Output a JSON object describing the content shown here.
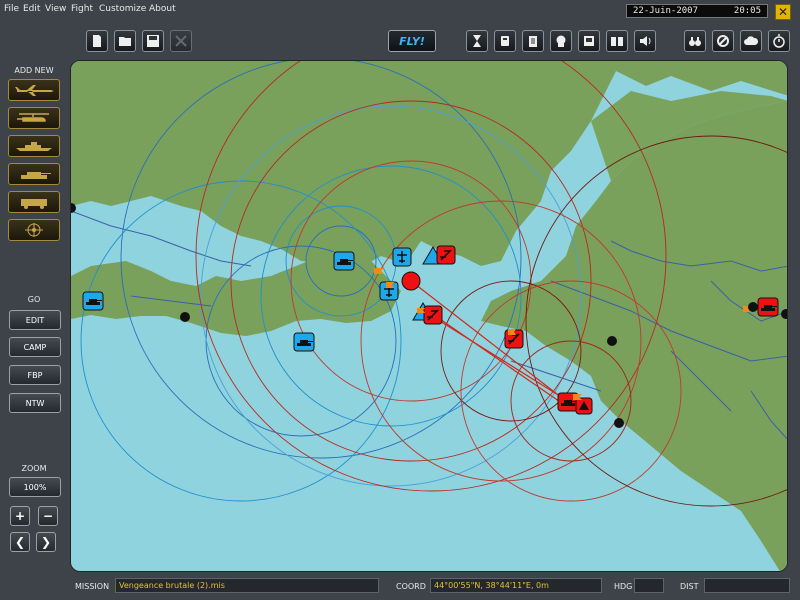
{
  "menu": [
    "File",
    "Edit",
    "View",
    "Fight",
    "Customize",
    "About"
  ],
  "clock": {
    "date": "22-Juin-2007",
    "time": "20:05"
  },
  "close_glyph": "✕",
  "toolbar_left": [
    {
      "name": "new-mission-button",
      "icon": "new-file-icon",
      "disabled": false
    },
    {
      "name": "open-mission-button",
      "icon": "open-folder-icon",
      "disabled": false
    },
    {
      "name": "save-mission-button",
      "icon": "save-disk-icon",
      "disabled": false
    },
    {
      "name": "delete-button",
      "icon": "delete-icon",
      "disabled": true
    }
  ],
  "fly_label": "FLY!",
  "toolbar_middle": [
    {
      "name": "time-button",
      "icon": "hourglass-icon"
    },
    {
      "name": "conditions-button",
      "icon": "conditions-icon"
    },
    {
      "name": "briefing-button",
      "icon": "clipboard-icon"
    },
    {
      "name": "pilot-button",
      "icon": "pilot-head-icon"
    },
    {
      "name": "description-button",
      "icon": "document-icon"
    },
    {
      "name": "library-button",
      "icon": "book-icon"
    },
    {
      "name": "sound-button",
      "icon": "speaker-icon"
    }
  ],
  "toolbar_right": [
    {
      "name": "recon-button",
      "icon": "binoculars-icon"
    },
    {
      "name": "no-fly-button",
      "icon": "prohibited-icon"
    },
    {
      "name": "weather-button",
      "icon": "cloud-icon"
    },
    {
      "name": "clock-button",
      "icon": "stopwatch-icon"
    }
  ],
  "add_new": {
    "label": "ADD NEW",
    "items": [
      {
        "name": "add-plane-button",
        "icon": "plane-icon"
      },
      {
        "name": "add-helicopter-button",
        "icon": "helicopter-icon"
      },
      {
        "name": "add-ship-button",
        "icon": "ship-icon"
      },
      {
        "name": "add-tank-button",
        "icon": "tank-icon"
      },
      {
        "name": "add-vehicle-button",
        "icon": "vehicle-icon"
      },
      {
        "name": "add-target-button",
        "icon": "target-icon"
      }
    ]
  },
  "go": {
    "label": "GO",
    "items": [
      "EDIT",
      "CAMP",
      "FBP",
      "NTW"
    ]
  },
  "zoom": {
    "label": "ZOOM",
    "value": "100%",
    "plus": "+",
    "minus": "−",
    "left": "❮",
    "right": "❯"
  },
  "status": {
    "mission_label": "MISSION",
    "mission_value": "Vengeance brutale (2).mis",
    "coord_label": "COORD",
    "coord_value": "44°00'55\"N, 38°44'11\"E, 0m",
    "hdg_label": "HDG",
    "hdg_value": "",
    "dist_label": "DIST",
    "dist_value": ""
  },
  "colors": {
    "sea": "#8fd3df",
    "land": "#79a15c",
    "blue_coalition": "#1ea8ea",
    "red_coalition": "#ee1111",
    "blue_range": "#2a6fb8",
    "red_range": "#b8281e"
  },
  "map_units": {
    "blue": [
      {
        "type": "tank",
        "label": "blue-tank-unit"
      },
      {
        "type": "tank",
        "label": "blue-tank-unit"
      },
      {
        "type": "tank",
        "label": "blue-tank-unit"
      },
      {
        "type": "airfield",
        "label": "blue-airfield-unit"
      },
      {
        "type": "airfield",
        "label": "blue-airfield-unit"
      },
      {
        "type": "sam",
        "label": "blue-sam-unit"
      },
      {
        "type": "sam",
        "label": "blue-sam-unit"
      }
    ],
    "red": [
      {
        "type": "airfield",
        "label": "red-airfield-unit"
      },
      {
        "type": "airfield",
        "label": "red-airfield-unit"
      },
      {
        "type": "airfield",
        "label": "red-airfield-unit"
      },
      {
        "type": "tank",
        "label": "red-tank-unit"
      },
      {
        "type": "tank",
        "label": "red-tank-unit"
      },
      {
        "type": "sam",
        "label": "red-sam-unit"
      }
    ]
  }
}
